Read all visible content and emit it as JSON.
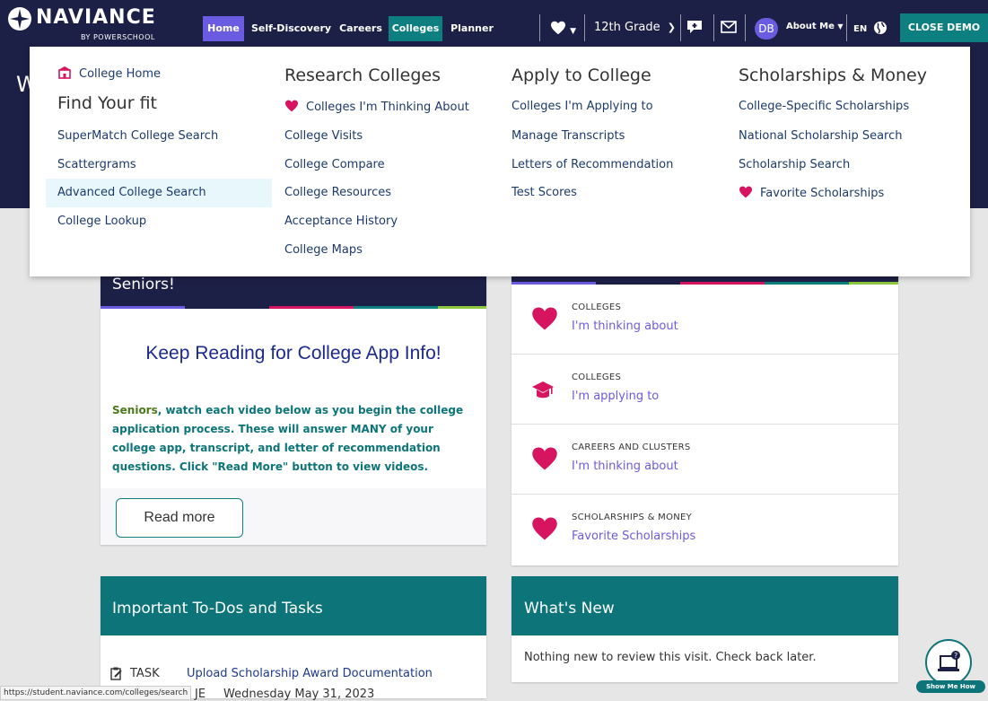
{
  "brand": {
    "name": "NAVIANCE",
    "sub": "BY POWERSCHOOL"
  },
  "nav": {
    "tabs": [
      "Home",
      "Self-Discovery",
      "Careers",
      "Colleges",
      "Planner"
    ],
    "grade": "12th Grade",
    "avatar_initials": "DB",
    "about_me": "About Me",
    "language": "EN",
    "close_demo": "CLOSE DEMO"
  },
  "hero": {
    "partial_text": "W"
  },
  "dropdown": {
    "col1": {
      "home_link": "College Home",
      "heading": "Find Your fit",
      "links": [
        "SuperMatch College Search",
        "Scattergrams",
        "Advanced College Search",
        "College Lookup"
      ]
    },
    "col2": {
      "heading": "Research Colleges",
      "links": [
        "Colleges I'm Thinking About",
        "College Visits",
        "College Compare",
        "College Resources",
        "Acceptance History",
        "College Maps"
      ]
    },
    "col3": {
      "heading": "Apply to College",
      "links": [
        "Colleges I'm Applying to",
        "Manage Transcripts",
        "Letters of Recommendation",
        "Test Scores"
      ]
    },
    "col4": {
      "heading": "Scholarships & Money",
      "links": [
        "College-Specific Scholarships",
        "National Scholarship Search",
        "Scholarship Search",
        "Favorite Scholarships"
      ]
    }
  },
  "seniors_card": {
    "header": "Seniors!",
    "title": "Keep Reading for College App Info!",
    "body_first": "Seniors",
    "body_rest": ", watch each video below as you begin the college application process. These will answer MANY of your college app, transcript, and letter of recommendation questions. Click \"Read More\" button to view videos.",
    "button": "Read more"
  },
  "favorites": [
    {
      "category": "COLLEGES",
      "link": "I'm thinking about",
      "icon": "heart-icon"
    },
    {
      "category": "COLLEGES",
      "link": "I'm applying to",
      "icon": "graduation-cap-icon"
    },
    {
      "category": "CAREERS AND CLUSTERS",
      "link": "I'm thinking about",
      "icon": "heart-icon"
    },
    {
      "category": "SCHOLARSHIPS & MONEY",
      "link": "Favorite Scholarships",
      "icon": "heart-icon"
    }
  ],
  "todos": {
    "header": "Important To-Dos and Tasks",
    "task_label": "TASK",
    "task_link": "Upload Scholarship Award Documentation",
    "due_partial": "JE",
    "due_date": "Wednesday May 31, 2023"
  },
  "whats_new": {
    "header": "What's New",
    "body": "Nothing new to review this visit. Check back later."
  },
  "help": {
    "label": "Show Me How"
  },
  "status_url": "https://student.naviance.com/colleges/search",
  "colors": {
    "navy": "#1d2046",
    "teal": "#0d7f80",
    "purple": "#6b5be0",
    "pink": "#d6145f"
  }
}
